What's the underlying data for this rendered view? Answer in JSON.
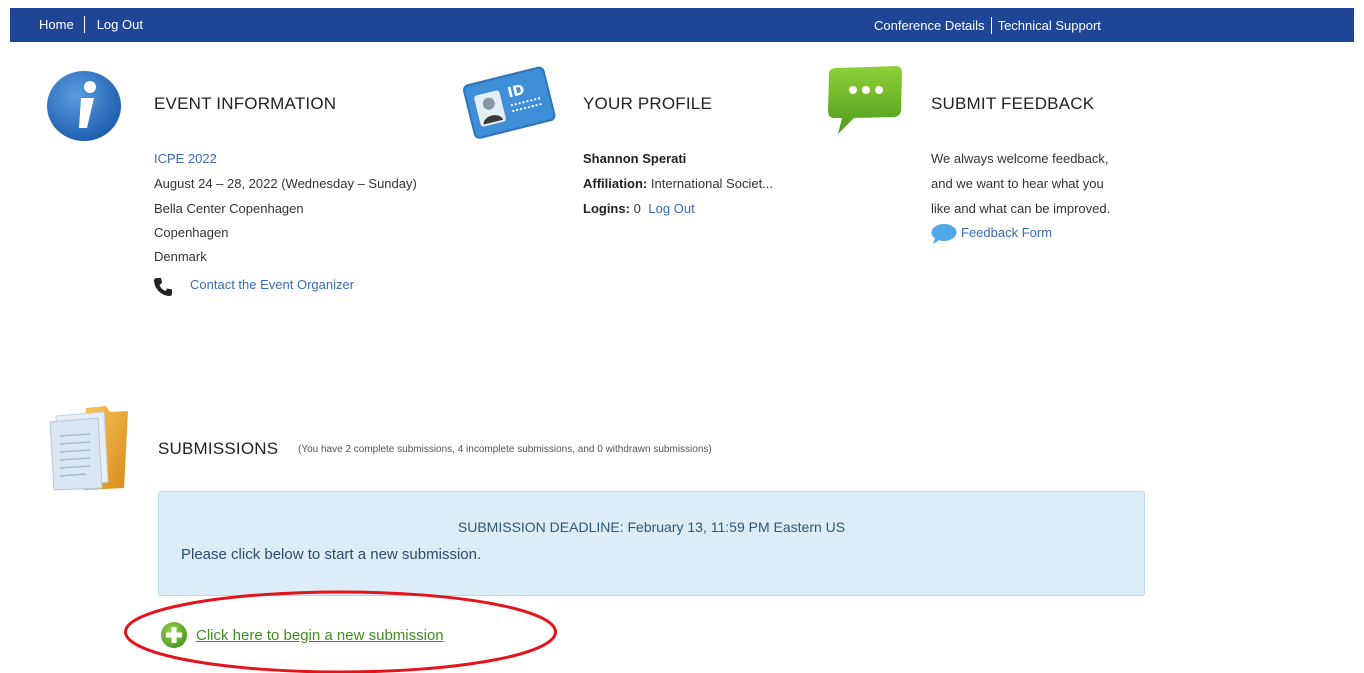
{
  "nav": {
    "home": "Home",
    "logout": "Log Out",
    "conference_details": "Conference Details",
    "technical_support": "Technical Support"
  },
  "event": {
    "title": "EVENT INFORMATION",
    "name": "ICPE 2022",
    "dates": "August 24 – 28, 2022 (Wednesday – Sunday)",
    "venue": "Bella Center Copenhagen",
    "city": "Copenhagen",
    "country": "Denmark",
    "contact": "Contact the Event Organizer"
  },
  "profile": {
    "title": "YOUR PROFILE",
    "name": "Shannon Sperati",
    "affiliation_label": "Affiliation:",
    "affiliation": "International Societ...",
    "logins_label": "Logins:",
    "logins": "0",
    "logout": "Log Out"
  },
  "feedback": {
    "title": "SUBMIT FEEDBACK",
    "line1": "We always welcome feedback,",
    "line2": "and we want to hear what you",
    "line3": "like and what can be improved.",
    "form_link": "Feedback Form"
  },
  "submissions": {
    "title": "SUBMISSIONS",
    "summary": "(You have 2 complete submissions, 4 incomplete submissions, and 0 withdrawn submissions)",
    "deadline": "SUBMISSION DEADLINE: February 13, 11:59 PM Eastern US",
    "instruction": "Please click below to start a new submission.",
    "new_link": "Click here to begin a new submission"
  },
  "colors": {
    "nav_bg": "#1f4597",
    "link": "#3a6bb3",
    "new_link": "#3f8f1f",
    "highlight": "#e3141b"
  },
  "icons": [
    "info-icon",
    "id-card-icon",
    "chat-bubble-icon",
    "phone-icon",
    "feedback-bubble-icon",
    "documents-folder-icon",
    "plus-circle-icon"
  ]
}
